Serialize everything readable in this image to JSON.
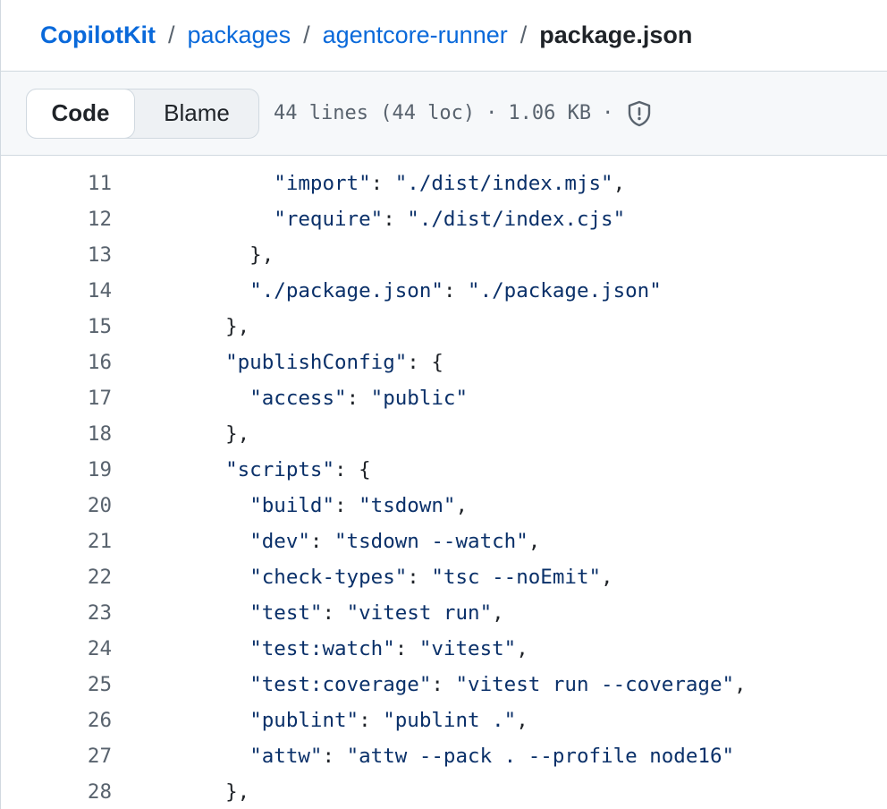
{
  "breadcrumb": {
    "items": [
      "CopilotKit",
      "packages",
      "agentcore-runner"
    ],
    "separator": "/",
    "current": "package.json"
  },
  "toolbar": {
    "code_label": "Code",
    "blame_label": "Blame",
    "lines_info": "44 lines (44 loc)",
    "size_info": "1.06 KB",
    "dot": "·",
    "security_icon": "shield-icon"
  },
  "code": {
    "lines": [
      {
        "n": "11",
        "text": "      \"import\": \"./dist/index.mjs\","
      },
      {
        "n": "12",
        "text": "      \"require\": \"./dist/index.cjs\""
      },
      {
        "n": "13",
        "text": "    },"
      },
      {
        "n": "14",
        "text": "    \"./package.json\": \"./package.json\""
      },
      {
        "n": "15",
        "text": "  },"
      },
      {
        "n": "16",
        "text": "  \"publishConfig\": {"
      },
      {
        "n": "17",
        "text": "    \"access\": \"public\""
      },
      {
        "n": "18",
        "text": "  },"
      },
      {
        "n": "19",
        "text": "  \"scripts\": {"
      },
      {
        "n": "20",
        "text": "    \"build\": \"tsdown\","
      },
      {
        "n": "21",
        "text": "    \"dev\": \"tsdown --watch\","
      },
      {
        "n": "22",
        "text": "    \"check-types\": \"tsc --noEmit\","
      },
      {
        "n": "23",
        "text": "    \"test\": \"vitest run\","
      },
      {
        "n": "24",
        "text": "    \"test:watch\": \"vitest\","
      },
      {
        "n": "25",
        "text": "    \"test:coverage\": \"vitest run --coverage\","
      },
      {
        "n": "26",
        "text": "    \"publint\": \"publint .\","
      },
      {
        "n": "27",
        "text": "    \"attw\": \"attw --pack . --profile node16\""
      },
      {
        "n": "28",
        "text": "  },"
      }
    ]
  },
  "colors": {
    "link": "#0969da",
    "string": "#0a3069",
    "muted": "#59636e",
    "border": "#d1d9e0",
    "toolbar_bg": "#f6f8fa"
  }
}
